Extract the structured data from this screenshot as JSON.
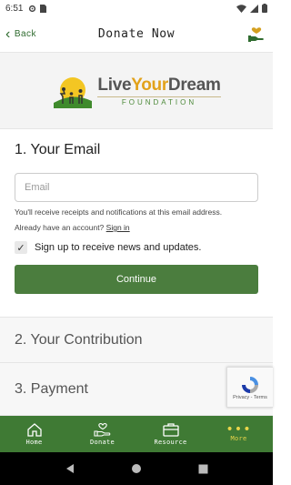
{
  "status_bar": {
    "time": "6:51"
  },
  "header": {
    "back_label": "Back",
    "title": "Donate Now"
  },
  "logo": {
    "word1": "Live",
    "word2": "Your",
    "word3": "Dream",
    "sub": "FOUNDATION"
  },
  "email_section": {
    "title": "1.  Your Email",
    "email_placeholder": "Email",
    "email_value": "",
    "note": "You'll receive receipts and notifications at this email address.",
    "have_account": "Already have an account?",
    "signin_label": "Sign in",
    "newsletter_label": "Sign up to receive news and updates.",
    "newsletter_checked": true,
    "continue_label": "Continue"
  },
  "contribution_section": {
    "title": "2.  Your Contribution"
  },
  "payment_section": {
    "title": "3.  Payment"
  },
  "recaptcha": {
    "text": "Privacy - Terms"
  },
  "bottom_nav": {
    "items": [
      {
        "label": "Home",
        "icon": "home-icon"
      },
      {
        "label": "Donate",
        "icon": "donate-hand-heart-icon"
      },
      {
        "label": "Resource",
        "icon": "briefcase-icon"
      },
      {
        "label": "More",
        "icon": "more-dots-icon",
        "active": true
      }
    ]
  },
  "colors": {
    "brand_green": "#3f7a34",
    "button_green": "#4b7d3e",
    "accent_gold": "#e2a21b",
    "active_nav": "#e9d54a"
  }
}
